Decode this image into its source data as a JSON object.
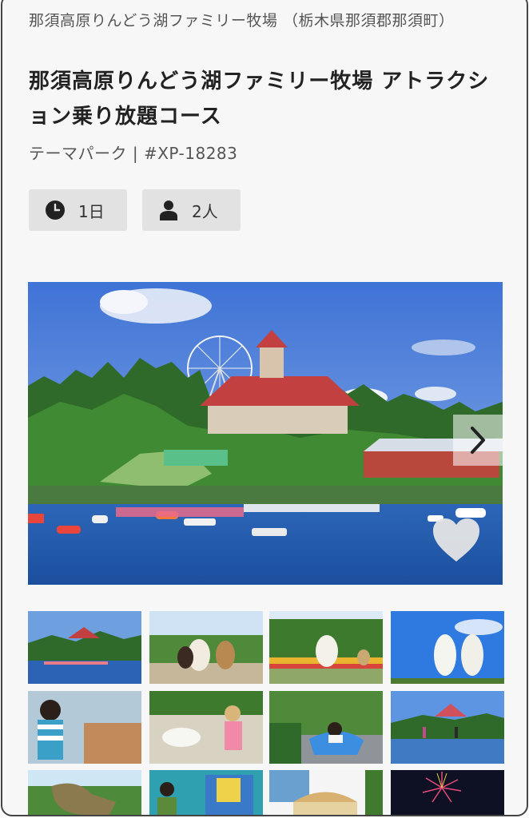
{
  "listing": {
    "location": "那須高原りんどう湖ファミリー牧場 （栃木県那須郡那須町）",
    "title": "那須高原りんどう湖ファミリー牧場 アトラクション乗り放題コース",
    "category": "テーマパーク | #XP-18283",
    "duration": "1日",
    "people": "2人"
  },
  "icons": {
    "duration": "clock-icon",
    "people": "person-icon",
    "next": "chevron-right-icon",
    "favorite": "heart-icon"
  },
  "gallery": {
    "thumbnails": [
      "lake-overview-photo",
      "alpacas-photo",
      "alpaca-flowerbed-photo",
      "alpacas-sky-photo",
      "boy-photo",
      "girl-goat-photo",
      "go-kart-photo",
      "lake-castle-photo",
      "dinosaur-photo",
      "kiosk-photo",
      "carousel-photo",
      "fireworks-photo"
    ]
  }
}
